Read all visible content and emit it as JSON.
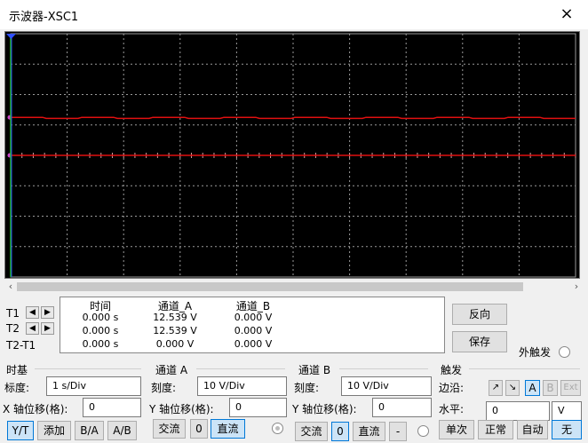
{
  "window": {
    "title": "示波器-XSC1",
    "close_icon": "×"
  },
  "readout": {
    "headers": {
      "time": "时间",
      "ch_a": "通道_A",
      "ch_b": "通道_B"
    },
    "rows": [
      {
        "label": "T1",
        "time": "0.000 s",
        "a": "12.539 V",
        "b": "0.000 V"
      },
      {
        "label": "T2",
        "time": "0.000 s",
        "a": "12.539 V",
        "b": "0.000 V"
      },
      {
        "label": "T2-T1",
        "time": "0.000 s",
        "a": "0.000 V",
        "b": "0.000 V"
      }
    ]
  },
  "buttons": {
    "reverse": "反向",
    "save": "保存"
  },
  "external_trigger": "外触发",
  "timebase": {
    "heading": "时基",
    "scale_label": "标度:",
    "scale_value": "1  s/Div",
    "xpos_label": "X 轴位移(格):",
    "xpos_value": "0",
    "modes": [
      "Y/T",
      "添加",
      "B/A",
      "A/B"
    ],
    "active_mode": "Y/T"
  },
  "channel_a": {
    "heading": "通道 A",
    "scale_label": "刻度:",
    "scale_value": "10  V/Div",
    "ypos_label": "Y 轴位移(格):",
    "ypos_value": "0",
    "coupling": [
      "交流",
      "0",
      "直流"
    ],
    "active_coupling": "直流"
  },
  "channel_b": {
    "heading": "通道 B",
    "scale_label": "刻度:",
    "scale_value": "10  V/Div",
    "ypos_label": "Y 轴位移(格):",
    "ypos_value": "0",
    "coupling": [
      "交流",
      "0",
      "直流",
      "-"
    ],
    "active_coupling": "0"
  },
  "trigger": {
    "heading": "触发",
    "edge_label": "边沿:",
    "edge_rise": "↗",
    "edge_fall": "↘",
    "sources": [
      "A",
      "B",
      "Ext"
    ],
    "level_label": "水平:",
    "level_value": "0",
    "level_unit": "V",
    "modes": [
      "单次",
      "正常",
      "自动",
      "无"
    ],
    "active_mode": "无"
  },
  "colors": {
    "screen_bg": "#000000",
    "grid": "#9a9a9a",
    "trace_a": "#e01010",
    "cursor1": "#3050ff",
    "cursor2": "#20c020"
  },
  "chart_data": {
    "type": "line",
    "series": [
      {
        "name": "A",
        "trace_level_div": 1.25,
        "volts_per_div": 10
      },
      {
        "name": "B",
        "trace_level_div": 0
      }
    ],
    "grid": true,
    "x_divisions": 10,
    "y_divisions": 8
  }
}
